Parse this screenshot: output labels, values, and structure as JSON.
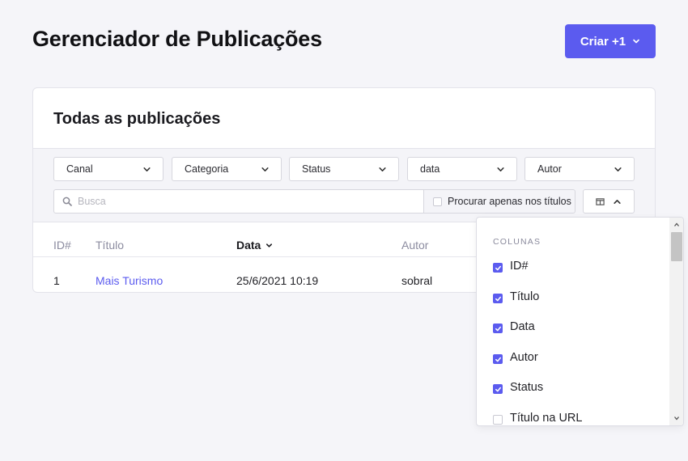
{
  "header": {
    "title": "Gerenciador de Publicações",
    "create_label": "Criar +1"
  },
  "card": {
    "title": "Todas as publicações"
  },
  "filters": {
    "selects": [
      "Canal",
      "Categoria",
      "Status",
      "data",
      "Autor"
    ],
    "search_placeholder": "Busca",
    "title_only_label": "Procurar apenas nos títulos"
  },
  "table": {
    "headers": [
      "ID#",
      "Título",
      "Data",
      "Autor"
    ],
    "sorted_column": "Data",
    "rows": [
      {
        "id": "1",
        "title": "Mais Turismo",
        "date": "25/6/2021 10:19",
        "author": "sobral"
      }
    ]
  },
  "columns_menu": {
    "heading": "COLUNAS",
    "items": [
      {
        "label": "ID#",
        "checked": true
      },
      {
        "label": "Título",
        "checked": true
      },
      {
        "label": "Data",
        "checked": true
      },
      {
        "label": "Autor",
        "checked": true
      },
      {
        "label": "Status",
        "checked": true
      },
      {
        "label": "Título na URL",
        "checked": false
      }
    ]
  },
  "colors": {
    "accent": "#5b5bef",
    "background": "#f5f5f9"
  }
}
